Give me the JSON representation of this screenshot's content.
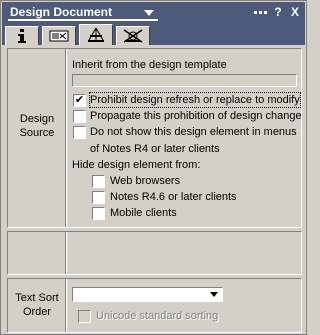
{
  "titlebar": {
    "title": "Design Document",
    "help_label": "?",
    "close_label": "X"
  },
  "tabs": [
    {
      "name": "info",
      "icon": "info-icon"
    },
    {
      "name": "fields",
      "icon": "fields-icon"
    },
    {
      "name": "design",
      "icon": "design-icon",
      "active": true
    },
    {
      "name": "advanced",
      "icon": "advanced-icon"
    }
  ],
  "design_source": {
    "label_line1": "Design",
    "label_line2": "Source",
    "inherit_label": "Inherit from the design template",
    "inherit_value": "",
    "options": [
      {
        "label": "Prohibit design refresh or replace to modify",
        "checked": true,
        "focused": true
      },
      {
        "label": "Propagate this prohibition of design change",
        "checked": false
      },
      {
        "label_line1": "Do not show this design element in menus",
        "label_line2": "of Notes R4 or later clients",
        "checked": false
      }
    ],
    "hide_label": "Hide design element from:",
    "hide_options": [
      {
        "label": "Web browsers",
        "checked": false
      },
      {
        "label": "Notes R4.6 or later clients",
        "checked": false
      },
      {
        "label": "Mobile clients",
        "checked": false
      }
    ]
  },
  "text_sort": {
    "label_line1": "Text Sort",
    "label_line2": "Order",
    "selected": "",
    "unicode_label": "Unicode standard sorting",
    "unicode_checked": false
  },
  "colors": {
    "titlebar_bg": "#4d5a7c",
    "panel_bg": "#d4d0c8"
  }
}
